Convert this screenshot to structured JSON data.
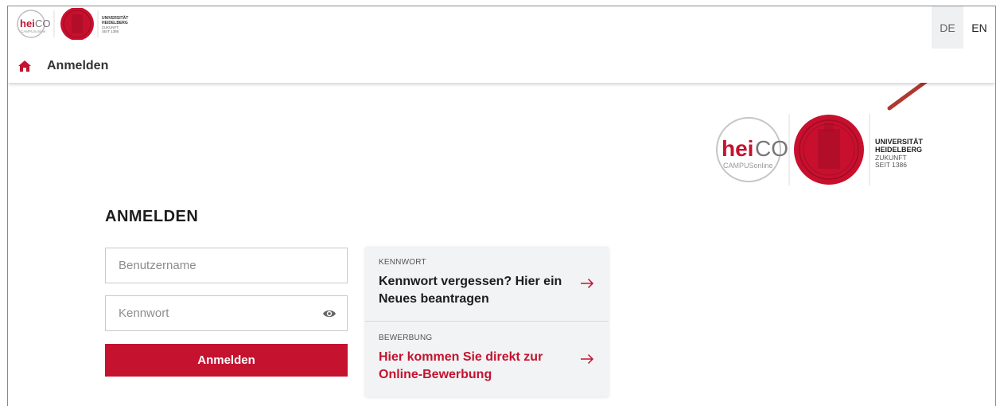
{
  "header": {
    "logo_small": {
      "brand_hei": "hei",
      "brand_co": "CO",
      "brand_sub": "CAMPUSonline",
      "uni_line1": "UNIVERSITÄT",
      "uni_line2": "HEIDELBERG",
      "uni_line3": "ZUKUNFT",
      "uni_line4": "SEIT 1386"
    },
    "languages": [
      "DE",
      "EN"
    ],
    "breadcrumb_label": "Anmelden"
  },
  "logo_large": {
    "brand_hei": "hei",
    "brand_co": "CO",
    "brand_sub": "CAMPUSonline",
    "uni_line1": "UNIVERSITÄT",
    "uni_line2": "HEIDELBERG",
    "uni_line3": "ZUKUNFT",
    "uni_line4": "SEIT 1386"
  },
  "login": {
    "title": "ANMELDEN",
    "username_placeholder": "Benutzername",
    "password_placeholder": "Kennwort",
    "submit_label": "Anmelden"
  },
  "cards": [
    {
      "kicker": "KENNWORT",
      "text": "Kennwort vergessen? Hier ein Neues beantragen"
    },
    {
      "kicker": "BEWERBUNG",
      "text": "Hier kommen Sie direkt zur Online-Bewerbung"
    }
  ],
  "colors": {
    "accent": "#c4122f",
    "seal": "#c8102e",
    "annotation_arrow": "#b0382f",
    "lang_active_bg": "#eef0f1"
  }
}
